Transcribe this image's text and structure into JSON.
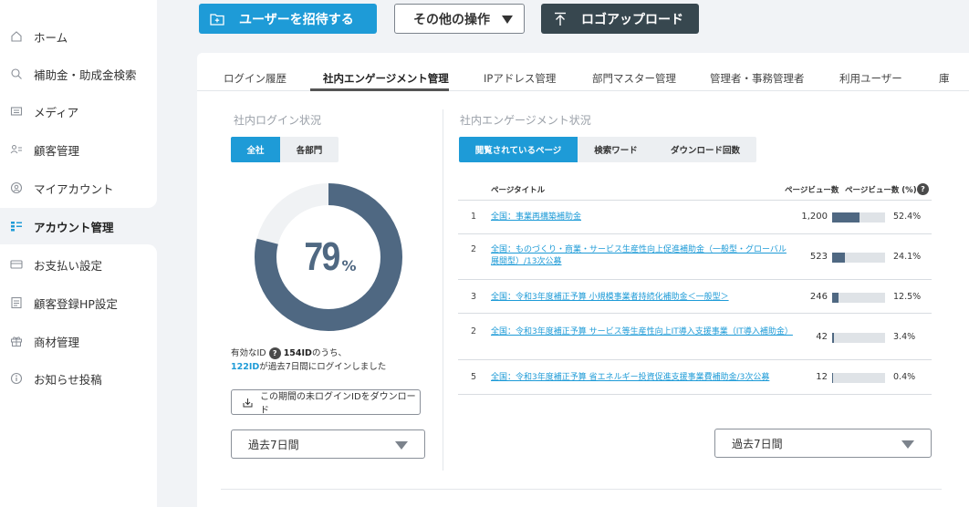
{
  "sidebar": {
    "items": [
      {
        "label": "ホーム",
        "icon": "home-icon"
      },
      {
        "label": "補助金・助成金検索",
        "icon": "search-icon"
      },
      {
        "label": "メディア",
        "icon": "media-icon"
      },
      {
        "label": "顧客管理",
        "icon": "customer-icon"
      },
      {
        "label": "マイアカウント",
        "icon": "user-circle-icon"
      },
      {
        "label": "アカウント管理",
        "icon": "account-manage-icon"
      },
      {
        "label": "お支払い設定",
        "icon": "card-icon"
      },
      {
        "label": "顧客登録HP設定",
        "icon": "document-icon"
      },
      {
        "label": "商材管理",
        "icon": "gift-icon"
      },
      {
        "label": "お知らせ投稿",
        "icon": "info-icon"
      }
    ]
  },
  "toolbar": {
    "invite_label": "ユーザーを招待する",
    "other_label": "その他の操作",
    "logo_upload_label": "ロゴアップロード"
  },
  "tabs": [
    "ログイン履歴",
    "社内エンゲージメント管理",
    "IPアドレス管理",
    "部門マスター管理",
    "管理者・事務管理者",
    "利用ユーザー",
    "庫"
  ],
  "login": {
    "title": "社内ログイン状況",
    "seg": [
      "全社",
      "各部門"
    ],
    "percent": "79",
    "percent_value": 79,
    "percent_unit": "%",
    "info_prefix": "有効なID",
    "info_total": "154ID",
    "info_mid": "のうち、",
    "info_logged": "122ID",
    "info_suffix": "が過去7日間にログインしました",
    "download_label": "この期間の未ログインIDをダウンロード",
    "period": "過去7日間"
  },
  "engagement": {
    "title": "社内エンゲージメント状況",
    "seg": [
      "閲覧されているページ",
      "検索ワード",
      "ダウンロード回数"
    ],
    "col_title": "ページタイトル",
    "col_pv": "ページビュー数",
    "col_pct": "ページビュー数 (%)",
    "rows": [
      {
        "idx": "1",
        "title": "全国：事業再構築補助金",
        "pv": "1,200",
        "pct": "52.4%",
        "ratio": 52.4
      },
      {
        "idx": "2",
        "title": "全国：ものづくり・商業・サービス生産性向上促進補助金（一般型・グローバル展開型）/13次公募",
        "pv": "523",
        "pct": "24.1%",
        "ratio": 24.1
      },
      {
        "idx": "3",
        "title": "全国：令和3年度補正予算 小規模事業者持続化補助金＜一般型＞",
        "pv": "246",
        "pct": "12.5%",
        "ratio": 12.5
      },
      {
        "idx": "2",
        "title": "全国：令和3年度補正予算 サービス等生産性向上IT導入支援事業（IT導入補助金）",
        "pv": "42",
        "pct": "3.4%",
        "ratio": 3.4
      },
      {
        "idx": "5",
        "title": "全国：令和3年度補正予算 省エネルギー投資促進支援事業費補助金/3次公募",
        "pv": "12",
        "pct": "0.4%",
        "ratio": 0.4
      }
    ],
    "period": "過去7日間"
  },
  "colors": {
    "accent": "#1e9bd7",
    "dark": "#37474f",
    "donut": "#4f6882",
    "donut_track": "#f0f2f4"
  }
}
